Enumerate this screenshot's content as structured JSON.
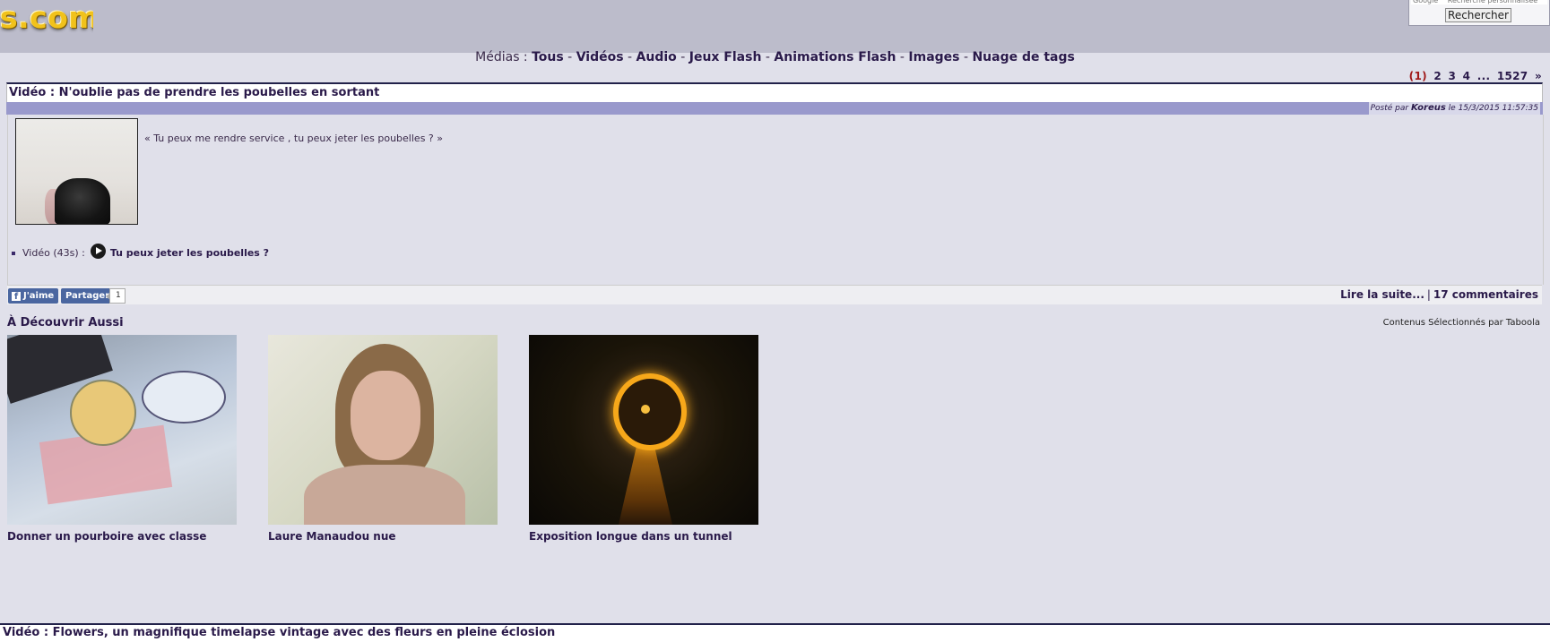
{
  "header": {
    "logo_text": "s.com",
    "search_placeholder": "Google™ Recherche personnalisée",
    "search_button": "Rechercher"
  },
  "media_nav": {
    "prefix": "Médias :",
    "links": [
      "Tous",
      "Vidéos",
      "Audio",
      "Jeux Flash",
      "Animations Flash",
      "Images",
      "Nuage de tags"
    ],
    "separator": "-"
  },
  "pagination": {
    "current": "(1)",
    "pages": [
      "2",
      "3",
      "4"
    ],
    "ellipsis": "...",
    "last": "1527",
    "next": "»"
  },
  "article": {
    "title": "Vidéo : N'oublie pas de prendre les poubelles en sortant",
    "posted_by_label": "Posté par",
    "author": "Koreus",
    "date": "le 15/3/2015 11:57:35",
    "quote": "« Tu peux me rendre service , tu peux jeter les poubelles ? »",
    "video_label": "Vidéo (43s) :",
    "video_link": "Tu peux jeter les poubelles ?",
    "like_label": "J'aime",
    "share_label": "Partager",
    "share_count": "1",
    "read_more": "Lire la suite...",
    "comments": "17 commentaires"
  },
  "discover": {
    "title": "À Découvrir Aussi",
    "sponsor": "Contenus Sélectionnés par Taboola",
    "items": [
      {
        "caption": "Donner un pourboire avec classe"
      },
      {
        "caption": "Laure Manaudou nue"
      },
      {
        "caption": "Exposition longue dans un tunnel"
      }
    ]
  },
  "next_article": {
    "title": "Vidéo : Flowers, un magnifique timelapse vintage avec des fleurs en pleine éclosion"
  },
  "colors": {
    "page_bg": "#e0e0ea",
    "header_bg": "#bcbccb",
    "posted_bar": "#9999cc",
    "link": "#2a1a4a",
    "page_current": "#a01818",
    "facebook": "#4a66a0"
  }
}
